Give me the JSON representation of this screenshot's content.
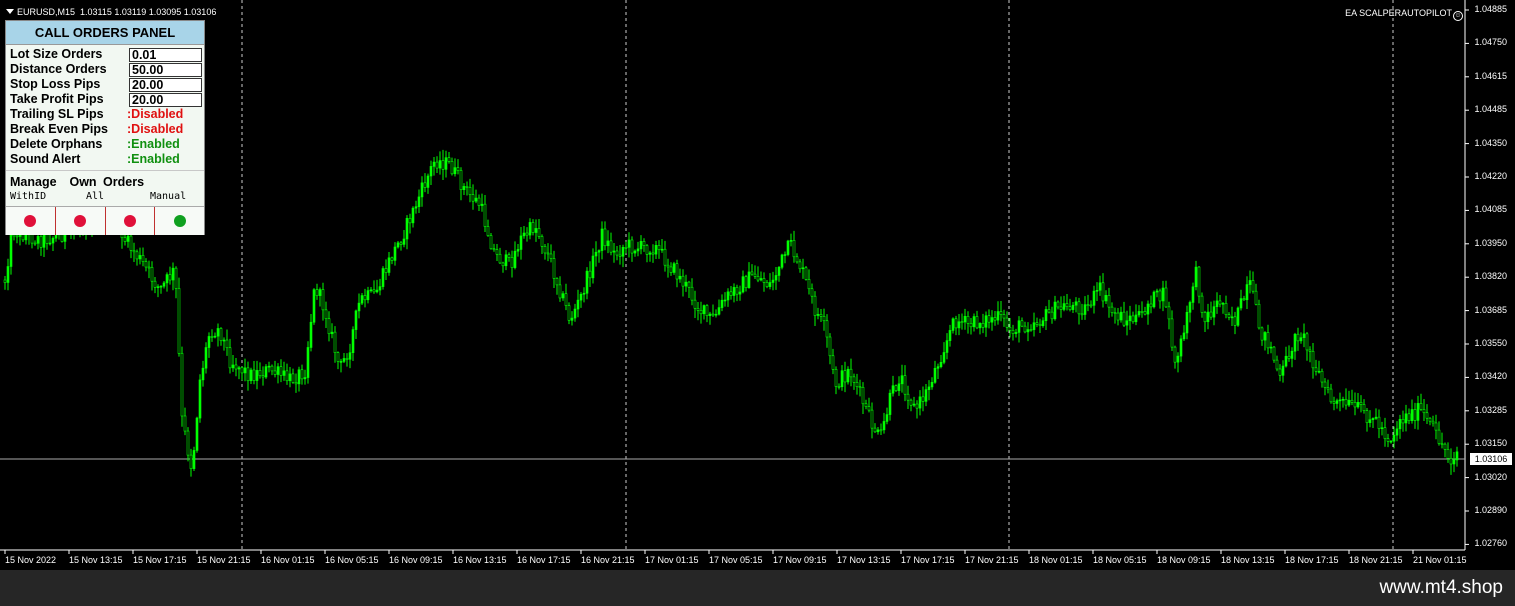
{
  "header": {
    "symbol": "EURUSD,M15",
    "ohlc": "1.03115 1.03119 1.03095 1.03106"
  },
  "ea_label": "EA SCALPERAUTOPILOT",
  "ea_icon": "smiley-icon",
  "panel": {
    "title": "CALL ORDERS PANEL",
    "fields": [
      {
        "label": "Lot Size Orders",
        "value": "0.01"
      },
      {
        "label": "Distance Orders",
        "value": "50.00"
      },
      {
        "label": "Stop Loss Pips",
        "value": "20.00"
      },
      {
        "label": "Take Profit Pips",
        "value": "20.00"
      }
    ],
    "statuses": [
      {
        "label": "Trailing SL Pips",
        "value": "Disabled",
        "state": "disabled"
      },
      {
        "label": "Break Even Pips",
        "value": "Disabled",
        "state": "disabled"
      },
      {
        "label": "Delete Orphans",
        "value": "Enabled",
        "state": "enabled"
      },
      {
        "label": "Sound Alert",
        "value": "Enabled",
        "state": "enabled"
      }
    ],
    "manage_title": "Manage  Own Orders",
    "options": [
      "WithID",
      "All",
      "Manual"
    ],
    "buttons": [
      {
        "color": "#e0103a"
      },
      {
        "color": "#e0103a"
      },
      {
        "color": "#e0103a"
      },
      {
        "color": "#10a020"
      }
    ]
  },
  "colors": {
    "candle": "#00ff00",
    "panel_title_bg": "#a8d4e8",
    "disabled": "#e01010",
    "enabled": "#109010"
  },
  "current_price": "1.03106",
  "price_axis": [
    "1.04885",
    "1.04750",
    "1.04615",
    "1.04485",
    "1.04350",
    "1.04220",
    "1.04085",
    "1.03950",
    "1.03820",
    "1.03685",
    "1.03550",
    "1.03420",
    "1.03285",
    "1.03150",
    "1.03020",
    "1.02890",
    "1.02760"
  ],
  "time_axis": [
    "15 Nov 2022",
    "15 Nov 13:15",
    "15 Nov 17:15",
    "15 Nov 21:15",
    "16 Nov 01:15",
    "16 Nov 05:15",
    "16 Nov 09:15",
    "16 Nov 13:15",
    "16 Nov 17:15",
    "16 Nov 21:15",
    "17 Nov 01:15",
    "17 Nov 05:15",
    "17 Nov 09:15",
    "17 Nov 13:15",
    "17 Nov 17:15",
    "17 Nov 21:15",
    "18 Nov 01:15",
    "18 Nov 05:15",
    "18 Nov 09:15",
    "18 Nov 13:15",
    "18 Nov 17:15",
    "18 Nov 21:15",
    "21 Nov 01:15"
  ],
  "footer": {
    "site": "www.mt4.shop"
  }
}
